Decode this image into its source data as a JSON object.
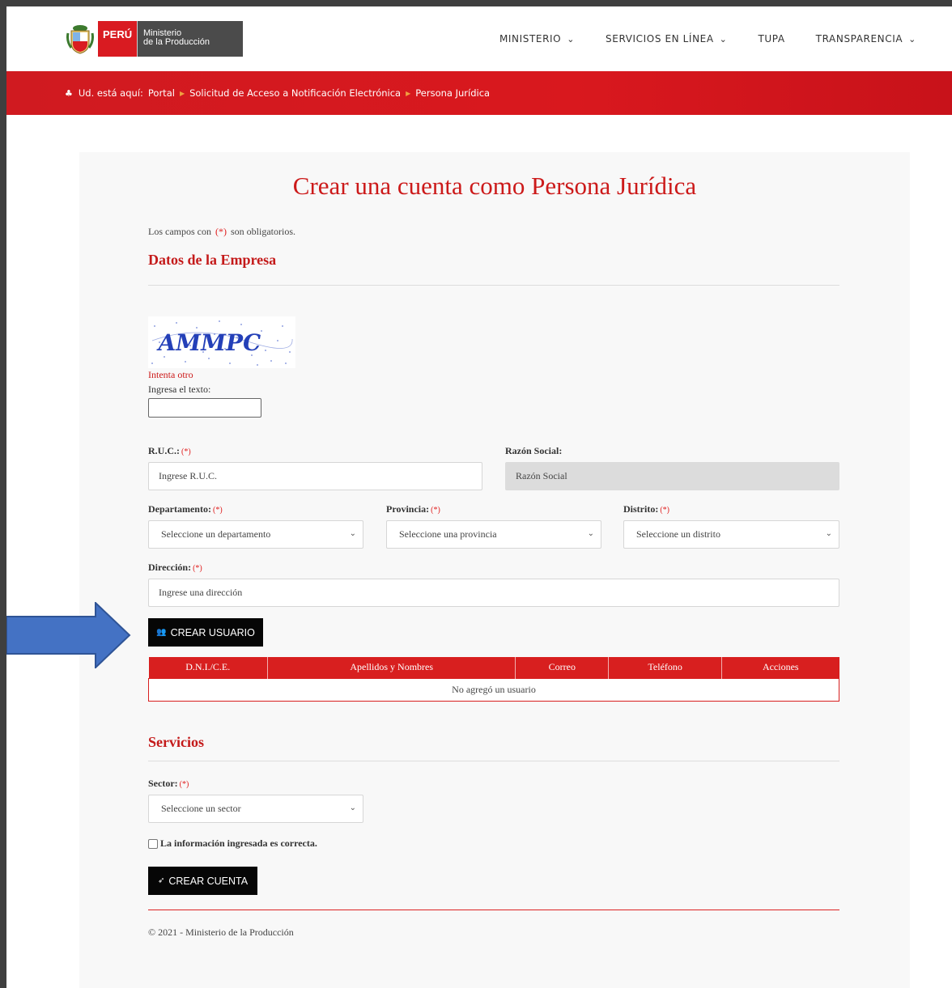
{
  "header": {
    "brand_country": "PERÚ",
    "brand_line1": "Ministerio",
    "brand_line2": "de la Producción",
    "nav": [
      {
        "label": "MINISTERIO",
        "dropdown": true
      },
      {
        "label": "SERVICIOS EN LÍNEA",
        "dropdown": true
      },
      {
        "label": "TUPA",
        "dropdown": false
      },
      {
        "label": "TRANSPARENCIA",
        "dropdown": true
      }
    ]
  },
  "breadcrumb": {
    "prefix": "Ud. está aquí:",
    "items": [
      "Portal",
      "Solicitud de Acceso a Notificación Electrónica",
      "Persona Jurídica"
    ]
  },
  "form": {
    "title": "Crear una cuenta como Persona Jurídica",
    "required_note_pre": "Los campos con",
    "required_mark": "(*)",
    "required_note_post": "son obligatorios.",
    "section_company": "Datos de la Empresa",
    "captcha_text": "AMMPC",
    "captcha_retry": "Intenta otro",
    "captcha_label": "Ingresa el texto:",
    "ruc_label": "R.U.C.:",
    "ruc_placeholder": "Ingrese R.U.C.",
    "razon_label": "Razón Social:",
    "razon_placeholder": "Razón Social",
    "dep_label": "Departamento:",
    "dep_value": "Seleccione un departamento",
    "prov_label": "Provincia:",
    "prov_value": "Seleccione una provincia",
    "dist_label": "Distrito:",
    "dist_value": "Seleccione un distrito",
    "dir_label": "Dirección:",
    "dir_placeholder": "Ingrese una dirección",
    "create_user_button": "CREAR USUARIO",
    "table_headers": [
      "D.N.I./C.E.",
      "Apellidos y Nombres",
      "Correo",
      "Teléfono",
      "Acciones"
    ],
    "table_empty": "No agregó un usuario",
    "section_services": "Servicios",
    "sector_label": "Sector:",
    "sector_value": "Seleccione un sector",
    "confirm_label": "La información ingresada es correcta.",
    "create_account_button": "CREAR CUENTA",
    "copyright": "© 2021 - Ministerio de la Producción"
  },
  "colors": {
    "accent_red": "#d81f1f",
    "title_red": "#cc1a1a",
    "arrow_blue": "#4472c4"
  }
}
